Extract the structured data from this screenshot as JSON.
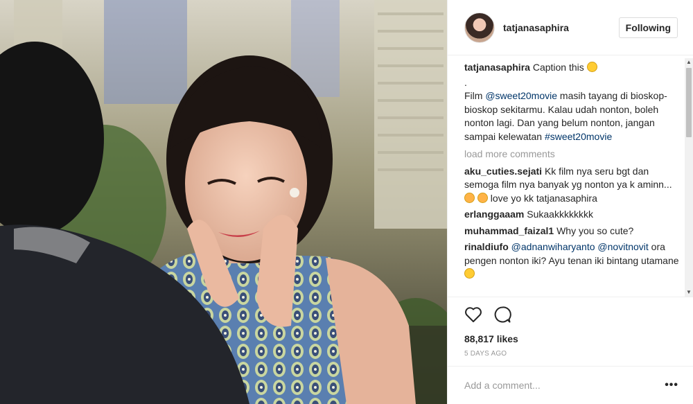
{
  "post": {
    "username": "tatjanasaphira",
    "follow_label": "Following",
    "caption": {
      "username": "tatjanasaphira",
      "text": "Caption this",
      "dot": ".",
      "body_pre": "Film ",
      "mention": "@sweet20movie",
      "body_post": " masih tayang di bioskop-bioskop sekitarmu. Kalau udah nonton, boleh nonton lagi. Dan yang belum nonton, jangan sampai kelewatan ",
      "hashtag": "#sweet20movie"
    },
    "load_more": "load more comments",
    "comments": [
      {
        "user": "aku_cuties.sejati",
        "text": "Kk film nya seru bgt dan semoga film nya banyak yg nonton ya k aminn...",
        "tail": " love yo kk tatjanasaphira"
      },
      {
        "user": "erlanggaaam",
        "text": "Sukaakkkkkkkk"
      },
      {
        "user": "muhammad_faizal1",
        "text": "Why you so cute?"
      },
      {
        "user": "rinaldiufo",
        "mention1": "@adnanwiharyanto",
        "mention2": "@novitnovit",
        "text": "ora pengen nonton iki? Ayu tenan iki bintang utamane"
      }
    ],
    "likes": "88,817 likes",
    "time": "5 DAYS AGO",
    "comment_placeholder": "Add a comment...",
    "more_options": "•••"
  },
  "icons": {
    "like": "heart-icon",
    "comment": "speech-bubble-icon",
    "options": "ellipsis-icon"
  },
  "colors": {
    "link": "#003569",
    "muted": "#999999",
    "text": "#262626",
    "border": "#efefef"
  }
}
